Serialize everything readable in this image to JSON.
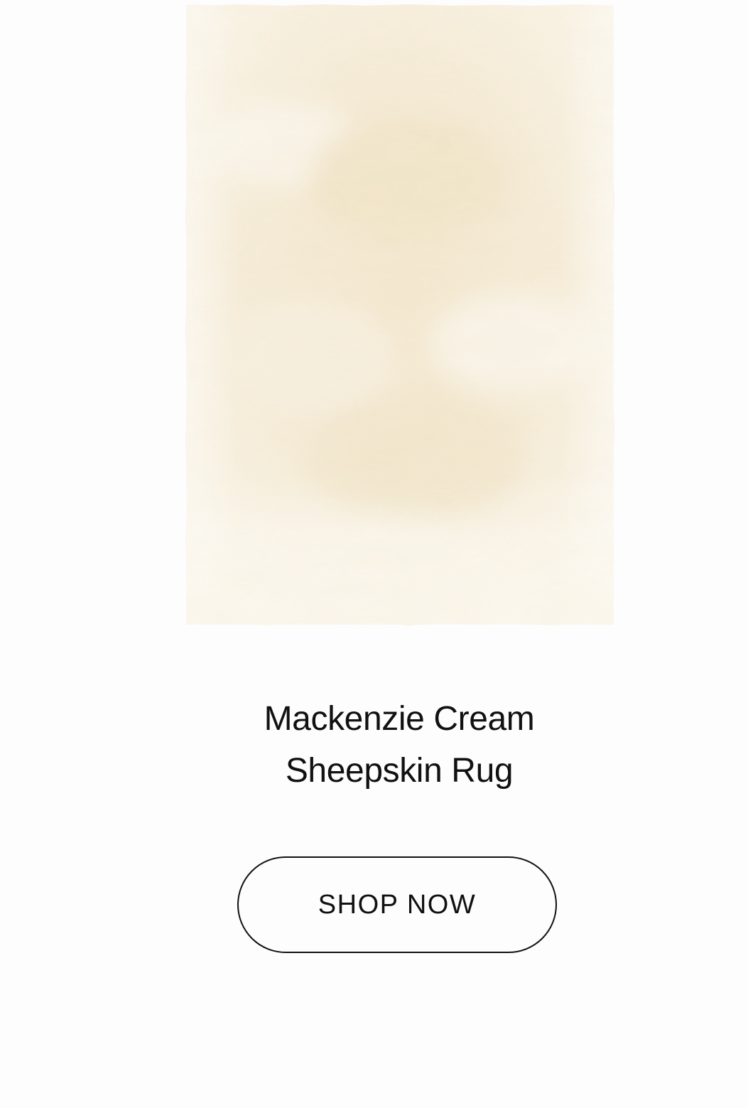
{
  "product": {
    "image_subject": "rug-image",
    "title_line_1": "Mackenzie Cream",
    "title_line_2": "Sheepskin Rug",
    "cta_label": "SHOP NOW"
  },
  "colors": {
    "background": "#fdfdfd",
    "rug_base": "#f3ead6",
    "rug_highlight": "#fbf8f0",
    "text": "#111111",
    "button_border": "#111111"
  }
}
